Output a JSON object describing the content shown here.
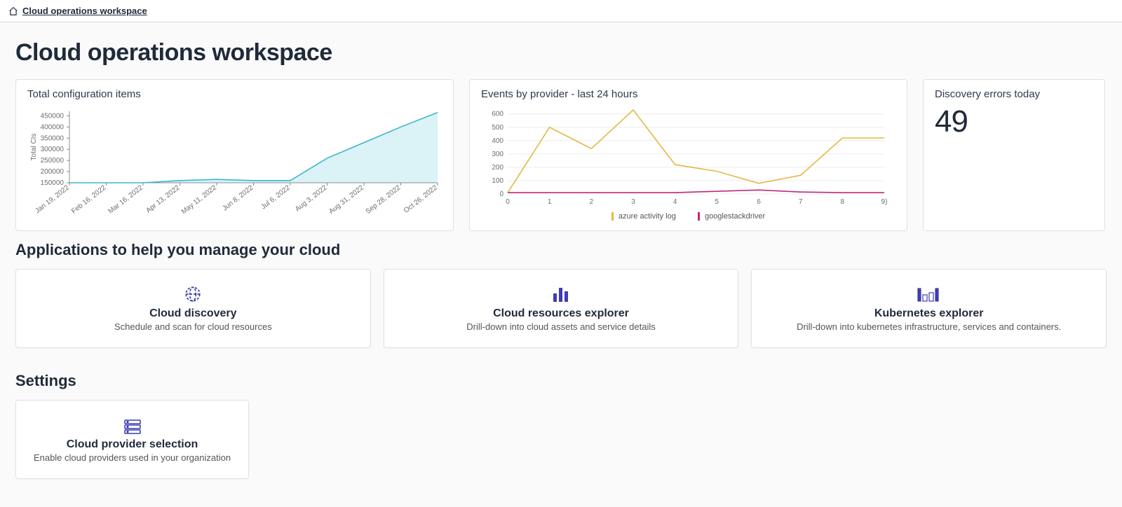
{
  "breadcrumb": {
    "label": "Cloud operations workspace"
  },
  "page_title": "Cloud operations workspace",
  "card_total_ci": {
    "title": "Total configuration items"
  },
  "card_events": {
    "title": "Events by provider - last 24 hours"
  },
  "card_errors": {
    "title": "Discovery errors today",
    "value": "49"
  },
  "chart_data": [
    {
      "id": "total_ci",
      "type": "area",
      "title": "Total configuration items",
      "ylabel": "Total CIs",
      "y_ticks": [
        150000,
        200000,
        250000,
        300000,
        350000,
        400000,
        450000
      ],
      "ylim": [
        150000,
        470000
      ],
      "categories": [
        "Jan 19, 2022",
        "Feb 16, 2022",
        "Mar 16, 2022",
        "Apr 13, 2022",
        "May 11, 2022",
        "Jun 8, 2022",
        "Jul 6, 2022",
        "Aug 3, 2022",
        "Aug 31, 2022",
        "Sep 28, 2022",
        "Oct 26, 2022"
      ],
      "values": [
        150000,
        150000,
        150000,
        160000,
        165000,
        160000,
        160000,
        260000,
        330000,
        400000,
        465000
      ],
      "color": "#3ab7cf"
    },
    {
      "id": "events",
      "type": "line",
      "title": "Events by provider - last 24 hours",
      "x": [
        0,
        1,
        2,
        3,
        4,
        5,
        6,
        7,
        8,
        9
      ],
      "x_range_label": "9)",
      "ylim": [
        0,
        630
      ],
      "y_ticks": [
        0,
        100,
        200,
        300,
        400,
        500,
        600
      ],
      "series": [
        {
          "name": "azure activity log",
          "color": "#e5b843",
          "values": [
            10,
            500,
            340,
            630,
            220,
            170,
            80,
            140,
            420,
            420
          ]
        },
        {
          "name": "googlestackdriver",
          "color": "#c0287a",
          "values": [
            10,
            10,
            10,
            10,
            10,
            20,
            30,
            15,
            10,
            10
          ]
        }
      ]
    }
  ],
  "apps_heading": "Applications to help you manage your cloud",
  "apps": [
    {
      "title": "Cloud discovery",
      "desc": "Schedule and scan for cloud resources"
    },
    {
      "title": "Cloud resources explorer",
      "desc": "Drill-down into cloud assets and service details"
    },
    {
      "title": "Kubernetes explorer",
      "desc": "Drill-down into kubernetes infrastructure, services and containers."
    }
  ],
  "settings_heading": "Settings",
  "settings": [
    {
      "title": "Cloud provider selection",
      "desc": "Enable cloud providers used in your organization"
    }
  ],
  "legend": {
    "items": [
      {
        "label": "azure activity log",
        "color": "#e5b843"
      },
      {
        "label": "googlestackdriver",
        "color": "#c0287a"
      }
    ]
  }
}
